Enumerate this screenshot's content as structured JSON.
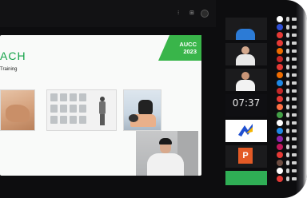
{
  "slide": {
    "title": "ACH",
    "subtitle": "Training",
    "badge_line1": "AUCC",
    "badge_line2": "2023"
  },
  "clock": {
    "time": "07:37"
  },
  "colors": {
    "accent_green": "#39b54a",
    "ppt_orange": "#e35a26",
    "frame_black": "#0d0d0f"
  },
  "icons": {
    "ppt_letter": "P"
  },
  "roster_avatar_colors": [
    "#ffffff",
    "#2f4fd6",
    "#e53935",
    "#e53935",
    "#ef6c00",
    "#c62828",
    "#e53935",
    "#ef6c00",
    "#1e88e5",
    "#c62828",
    "#e53935",
    "#ff7043",
    "#43a047",
    "#ffffff",
    "#1e88e5",
    "#8e24aa",
    "#c2185b",
    "#e53935",
    "#6d4c41",
    "#ffffff",
    "#e53935"
  ]
}
